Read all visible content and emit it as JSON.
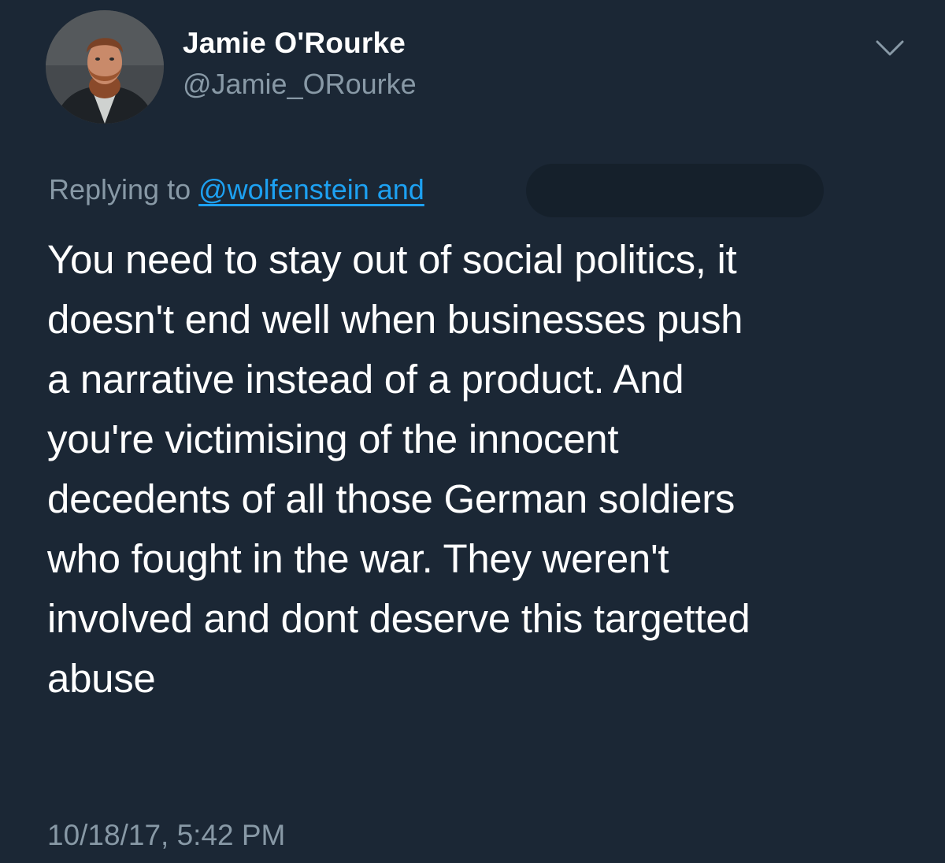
{
  "tweet": {
    "author": {
      "display_name": "Jamie O'Rourke",
      "handle": "@Jamie_ORourke",
      "avatar_icon": "profile-photo"
    },
    "more_icon": "chevron-down-icon",
    "reply": {
      "prefix": "Replying to ",
      "mentions": "@wolfenstein and",
      "redacted": true
    },
    "text_lines": [
      "You need to stay out of social politics, it",
      "doesn't end well when businesses push",
      "a narrative instead of a product. And",
      "you're victimising of the innocent",
      "decedents of all those German soldiers",
      "who fought in the war. They weren't",
      "involved and dont deserve this targetted",
      "abuse"
    ],
    "timestamp": "10/18/17, 5:42 PM"
  },
  "colors": {
    "background": "#1b2735",
    "text_primary": "#ffffff",
    "text_secondary": "#8899a6",
    "link": "#1da1f2",
    "redaction": "#15202b"
  }
}
